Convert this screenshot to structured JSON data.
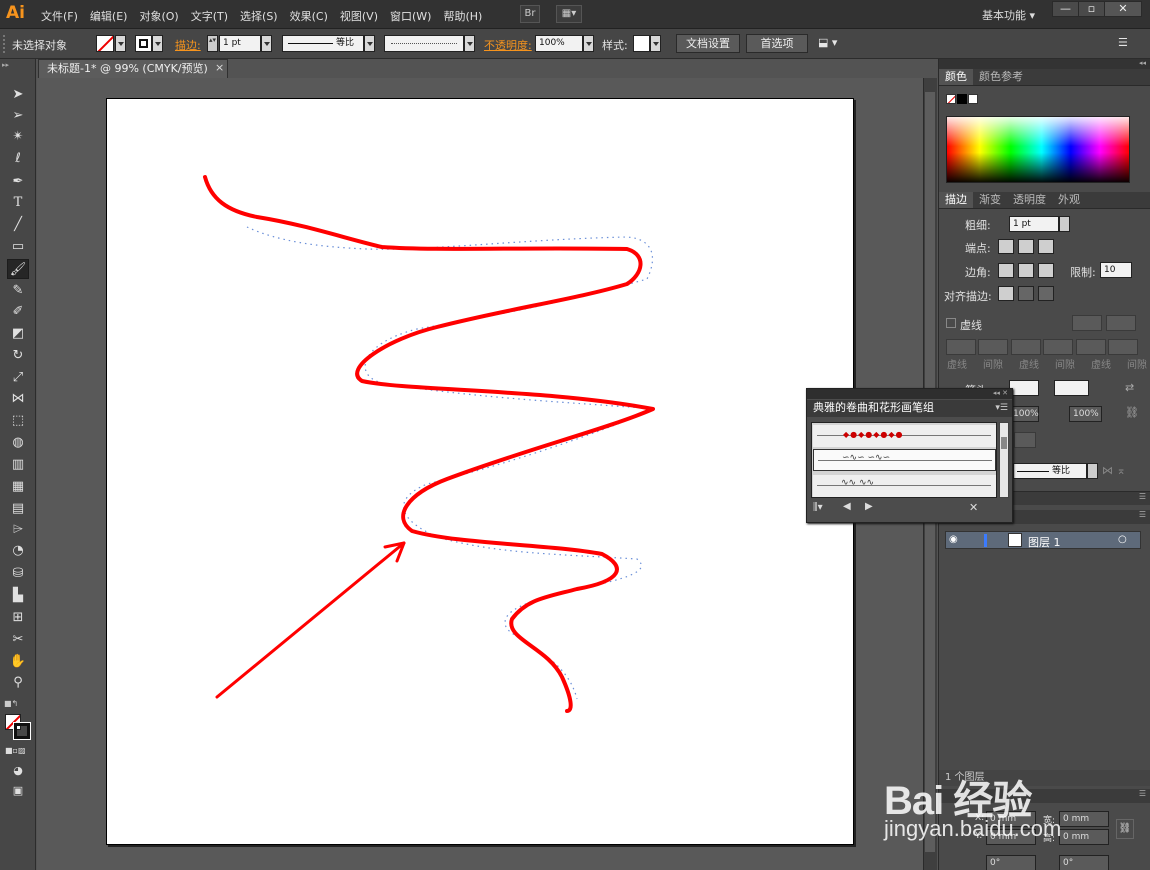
{
  "app": {
    "logo": "Ai",
    "menus": [
      "文件(F)",
      "编辑(E)",
      "对象(O)",
      "文字(T)",
      "选择(S)",
      "效果(C)",
      "视图(V)",
      "窗口(W)",
      "帮助(H)"
    ],
    "bridge_label": "Br",
    "workspace": "基本功能",
    "win_min": "—",
    "win_max": "▫",
    "win_close": "✕"
  },
  "control_bar": {
    "selection_status": "未选择对象",
    "stroke_label": "描边:",
    "stroke_weight": "1 pt",
    "stroke_profile": "等比",
    "opacity_label": "不透明度:",
    "opacity_value": "100%",
    "style_label": "样式:",
    "doc_setup_button": "文档设置",
    "preferences_button": "首选项"
  },
  "document": {
    "tab_title": "未标题-1* @ 99% (CMYK/预览)",
    "tab_close": "×"
  },
  "panels": {
    "color": {
      "tabs": [
        "颜色",
        "颜色参考"
      ]
    },
    "stroke": {
      "tabs": [
        "描边",
        "渐变",
        "透明度",
        "外观"
      ],
      "weight_label": "粗细:",
      "weight_value": "1 pt",
      "cap_label": "端点:",
      "corner_label": "边角:",
      "limit_label": "限制:",
      "limit_value": "10",
      "align_label": "对齐描边:",
      "dashed_label": "虚线",
      "dash_labels": [
        "虚线",
        "间隙",
        "虚线",
        "间隙",
        "虚线",
        "间隙"
      ],
      "arrow_label": "箭头:",
      "scale_a": "100%",
      "scale_b": "100%",
      "profile_value": "等比"
    },
    "layers": {
      "layer_name": "图层 1",
      "footer_label": "1 个图层"
    },
    "transform": {
      "x_label": "X:",
      "y_label": "Y:",
      "x_value": "0 mm",
      "y_value": "0 mm",
      "w_label": "宽:",
      "h_label": "高:",
      "w_value": "0 mm",
      "h_value": "0 mm",
      "rot_value": "0°",
      "shear_value": "0°"
    }
  },
  "brush_library": {
    "title": "典雅的卷曲和花形画笔组"
  },
  "watermark": {
    "logo_text": "Bai 经验",
    "url": "jingyan.baidu.com"
  },
  "colors": {
    "stroke_red": "#ff0000",
    "guide_blue": "#6a8fd8",
    "accent_orange": "#f7941d"
  }
}
